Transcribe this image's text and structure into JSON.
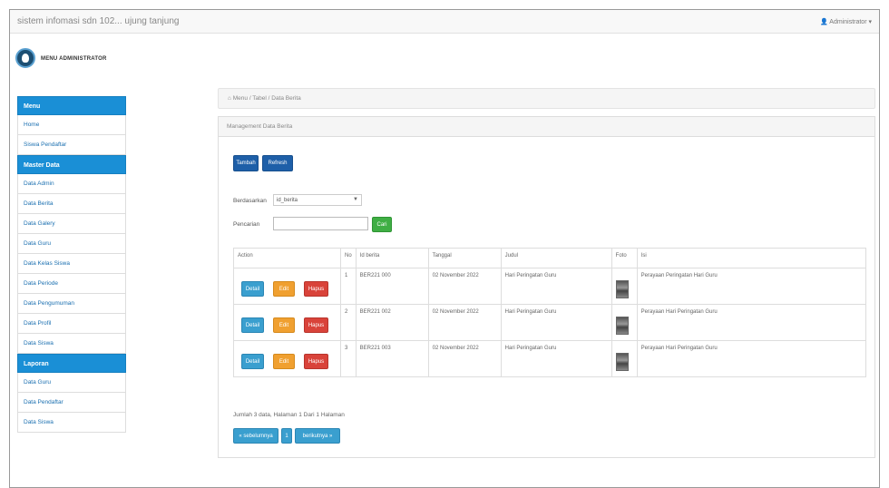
{
  "topbar": {
    "brand": "sistem infomasi sdn 102... ujung tanjung",
    "user": "Administrator"
  },
  "logo": {
    "text": "MENU ADMINISTRATOR"
  },
  "sidebar": {
    "sections": [
      {
        "title": "Menu",
        "items": [
          "Home",
          "Siswa Pendaftar"
        ]
      },
      {
        "title": "Master Data",
        "items": [
          "Data Admin",
          "Data Berita",
          "Data Galery",
          "Data Guru",
          "Data Kelas Siswa",
          "Data Periode",
          "Data Pengumuman",
          "Data Profil",
          "Data Siswa"
        ]
      },
      {
        "title": "Laporan",
        "items": [
          "Data Guru",
          "Data Pendaftar",
          "Data Siswa"
        ]
      }
    ]
  },
  "breadcrumb": "Menu / Tabel / Data Berita",
  "panel": {
    "heading": "Management Data Berita"
  },
  "buttons": {
    "add": "Tambah",
    "refresh": "Refresh",
    "search": "Cari"
  },
  "filter": {
    "sort_label": "Berdasarkan",
    "sort_value": "id_berita",
    "search_label": "Pencarian",
    "search_value": ""
  },
  "table": {
    "headers": [
      "Action",
      "No",
      "Id berita",
      "Tanggal",
      "Judul",
      "Foto",
      "Isi"
    ],
    "action_labels": {
      "view": "Detail",
      "edit": "Edit",
      "delete": "Hapus"
    },
    "rows": [
      {
        "no": "1",
        "id": "BER221 000",
        "tanggal": "02 November 2022",
        "judul": "Hari Peringatan Guru",
        "isi": "Perayaan Peringatan Hari Guru"
      },
      {
        "no": "2",
        "id": "BER221 002",
        "tanggal": "02 November 2022",
        "judul": "Hari Peringatan Guru",
        "isi": "Perayaan Hari Peringatan Guru"
      },
      {
        "no": "3",
        "id": "BER221 003",
        "tanggal": "02 November 2022",
        "judul": "Hari Peringatan Guru",
        "isi": "Perayaan Hari Peringatan Guru"
      }
    ]
  },
  "pagination": {
    "info": "Jumlah 3 data, Halaman 1 Dari 1 Halaman",
    "prev": "« sebelumnya",
    "current": "1",
    "next": "berikutnya »"
  }
}
